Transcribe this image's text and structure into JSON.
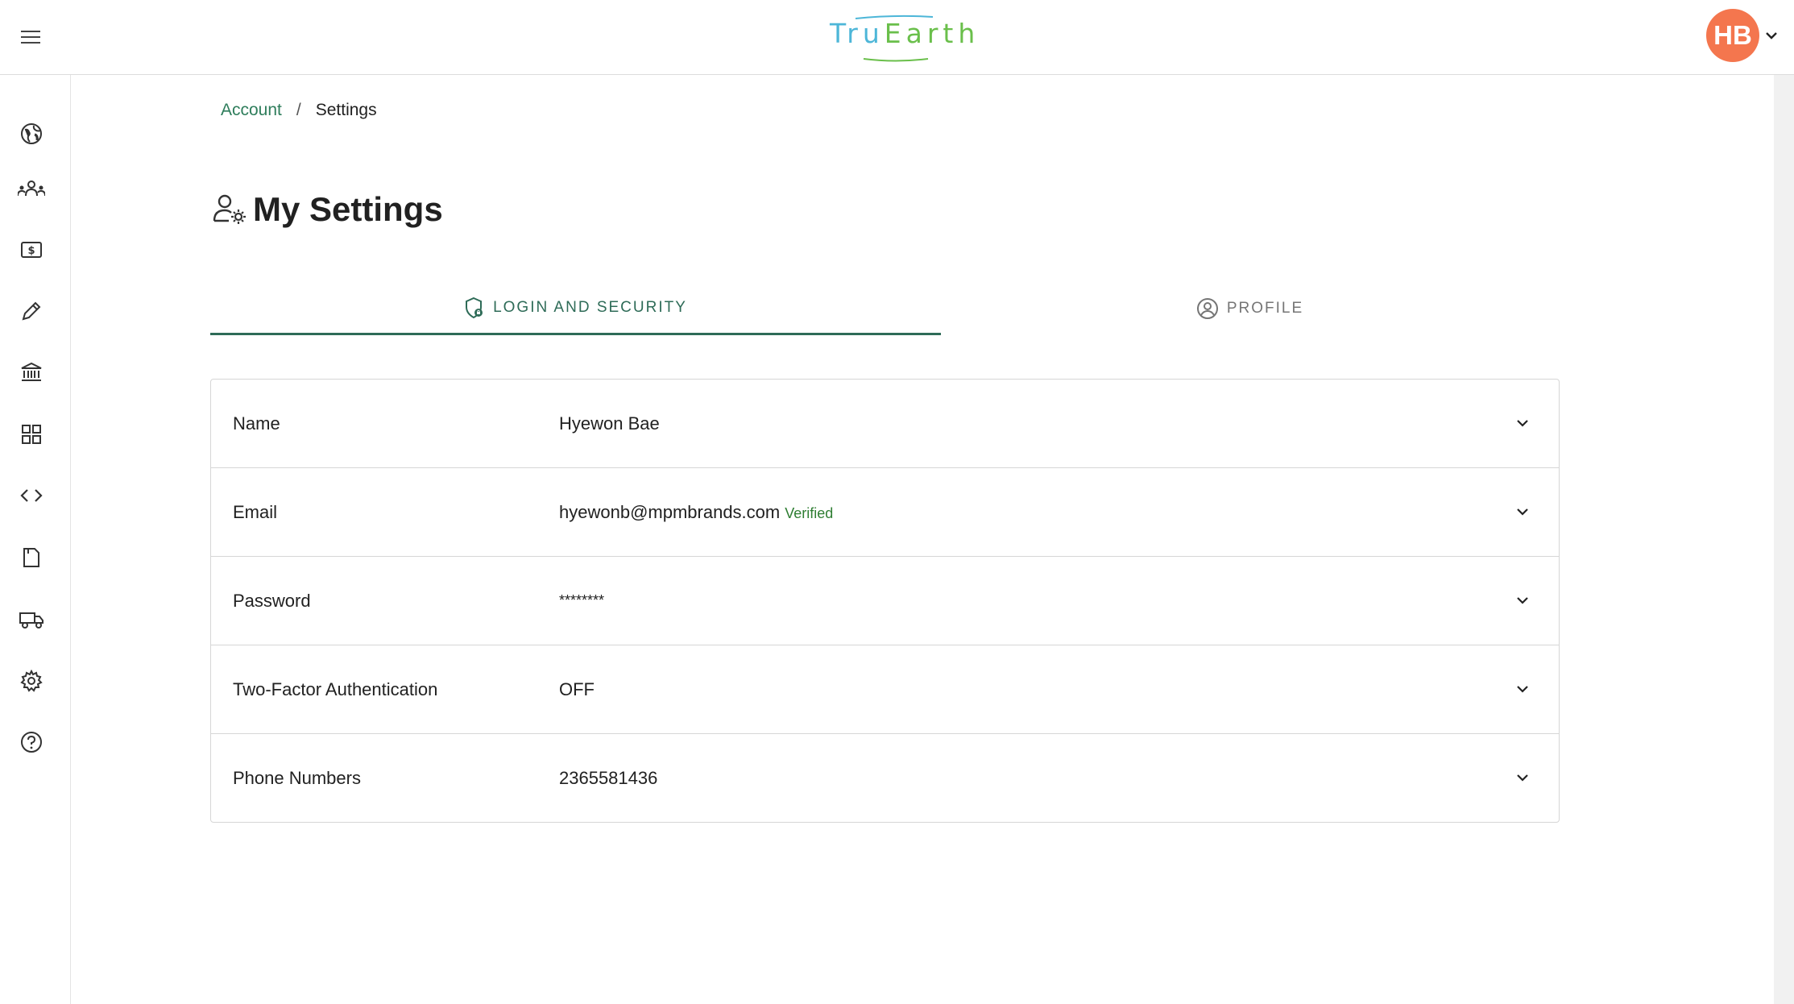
{
  "header": {
    "logo_text_part1": "Tru",
    "logo_text_part2": "Earth",
    "avatar_initials": "HB",
    "brand_colors": {
      "logo_blue": "#4db6d8",
      "logo_green": "#6abf4b",
      "avatar": "#f4764e",
      "accent": "#2e6b57"
    }
  },
  "sidebar": {
    "items": [
      {
        "icon": "globe-icon"
      },
      {
        "icon": "team-icon"
      },
      {
        "icon": "billing-icon"
      },
      {
        "icon": "pencil-icon"
      },
      {
        "icon": "bank-icon"
      },
      {
        "icon": "dashboard-icon"
      },
      {
        "icon": "code-icon"
      },
      {
        "icon": "document-icon"
      },
      {
        "icon": "truck-icon"
      },
      {
        "icon": "gear-icon"
      },
      {
        "icon": "help-icon"
      }
    ]
  },
  "breadcrumb": {
    "parent": "Account",
    "separator": "/",
    "current": "Settings"
  },
  "page": {
    "title": "My Settings"
  },
  "tabs": {
    "login": "LOGIN AND SECURITY",
    "profile": "PROFILE",
    "active": "login"
  },
  "settings": {
    "rows": [
      {
        "label": "Name",
        "value": "Hyewon Bae"
      },
      {
        "label": "Email",
        "value": "hyewonb@mpmbrands.com",
        "badge": "Verified"
      },
      {
        "label": "Password",
        "value": "********"
      },
      {
        "label": "Two-Factor Authentication",
        "value": "OFF"
      },
      {
        "label": "Phone Numbers",
        "value": "2365581436"
      }
    ]
  }
}
